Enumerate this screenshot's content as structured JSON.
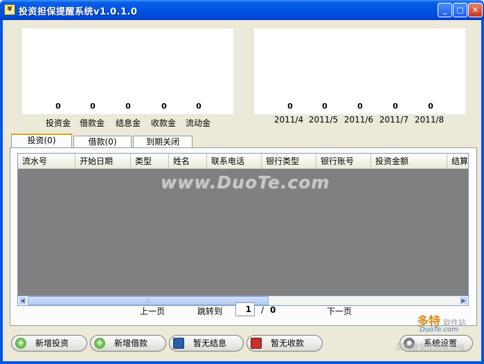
{
  "window": {
    "title": "投资担保提醒系统v1.0.1.0",
    "icon_name": "app-icon",
    "controls": [
      "minimize-button",
      "maximize-button",
      "close-button"
    ]
  },
  "left_chart": {
    "categories": [
      "投资金",
      "借款金",
      "结息金",
      "收款金",
      "流动金"
    ],
    "values": [
      "0",
      "0",
      "0",
      "0",
      "0"
    ]
  },
  "right_chart": {
    "categories": [
      "2011/4",
      "2011/5",
      "2011/6",
      "2011/7",
      "2011/8"
    ],
    "values": [
      "0",
      "0",
      "0",
      "0",
      "0"
    ]
  },
  "chart_data": [
    {
      "type": "bar",
      "categories": [
        "投资金",
        "借款金",
        "结息金",
        "收款金",
        "流动金"
      ],
      "values": [
        0,
        0,
        0,
        0,
        0
      ]
    },
    {
      "type": "bar",
      "categories": [
        "2011/4",
        "2011/5",
        "2011/6",
        "2011/7",
        "2011/8"
      ],
      "values": [
        0,
        0,
        0,
        0,
        0
      ]
    }
  ],
  "tabs": [
    {
      "label": "投资(0)",
      "active": true
    },
    {
      "label": "借款(0)",
      "active": false
    },
    {
      "label": "到期关闭",
      "active": false
    }
  ],
  "table": {
    "columns": [
      "流水号",
      "开始日期",
      "类型",
      "姓名",
      "联系电话",
      "银行类型",
      "银行账号",
      "投资金额",
      "结算"
    ]
  },
  "pager": {
    "prev": "上一页",
    "jump": "跳转到",
    "page": "1",
    "separator": "/",
    "total": "0",
    "next": "下一页"
  },
  "buttons": {
    "add_investment": "新增投资",
    "add_loan": "新增借款",
    "no_interest": "暂无结息",
    "no_payment": "暂无收款",
    "settings": "系统设置"
  },
  "watermark": {
    "text": "www.DuoTe.com",
    "logo_main": "多特",
    "logo_sub": "软件站",
    "logo_en": "DuoTe.com",
    "logo_foot": "国内最安全的软件站"
  },
  "colors": {
    "title_bar": "#0054e3",
    "grid_background": "#808080",
    "active_tab_accent": "#e3a21a"
  }
}
